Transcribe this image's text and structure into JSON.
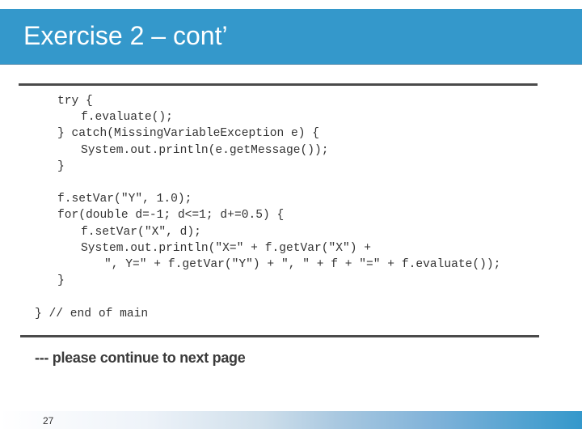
{
  "slide": {
    "title": "Exercise 2 – cont’",
    "code_lines": [
      {
        "indent": 0,
        "text": "try {"
      },
      {
        "indent": 1,
        "text": "f.evaluate();"
      },
      {
        "indent": 0,
        "text": "} catch(MissingVariableException e) {"
      },
      {
        "indent": 1,
        "text": "System.out.println(e.getMessage());"
      },
      {
        "indent": 0,
        "text": "}"
      },
      {
        "indent": 0,
        "text": ""
      },
      {
        "indent": 0,
        "text": "f.setVar(\"Y\", 1.0);"
      },
      {
        "indent": 0,
        "text": "for(double d=-1; d<=1; d+=0.5) {"
      },
      {
        "indent": 1,
        "text": "f.setVar(\"X\", d);"
      },
      {
        "indent": 1,
        "text": "System.out.println(\"X=\" + f.getVar(\"X\") +"
      },
      {
        "indent": 2,
        "text": "\", Y=\" + f.getVar(\"Y\") + \", \" + f + \"=\" + f.evaluate());"
      },
      {
        "indent": 0,
        "text": "}"
      },
      {
        "indent": 0,
        "text": ""
      },
      {
        "indent": -1,
        "text": "} // end of main"
      }
    ],
    "continue_note": "--- please continue to next page",
    "page_number": "27"
  },
  "colors": {
    "title_bar": "#3498cb",
    "title_text": "#ffffff",
    "rule": "#4a4a4a",
    "code_text": "#333333"
  }
}
